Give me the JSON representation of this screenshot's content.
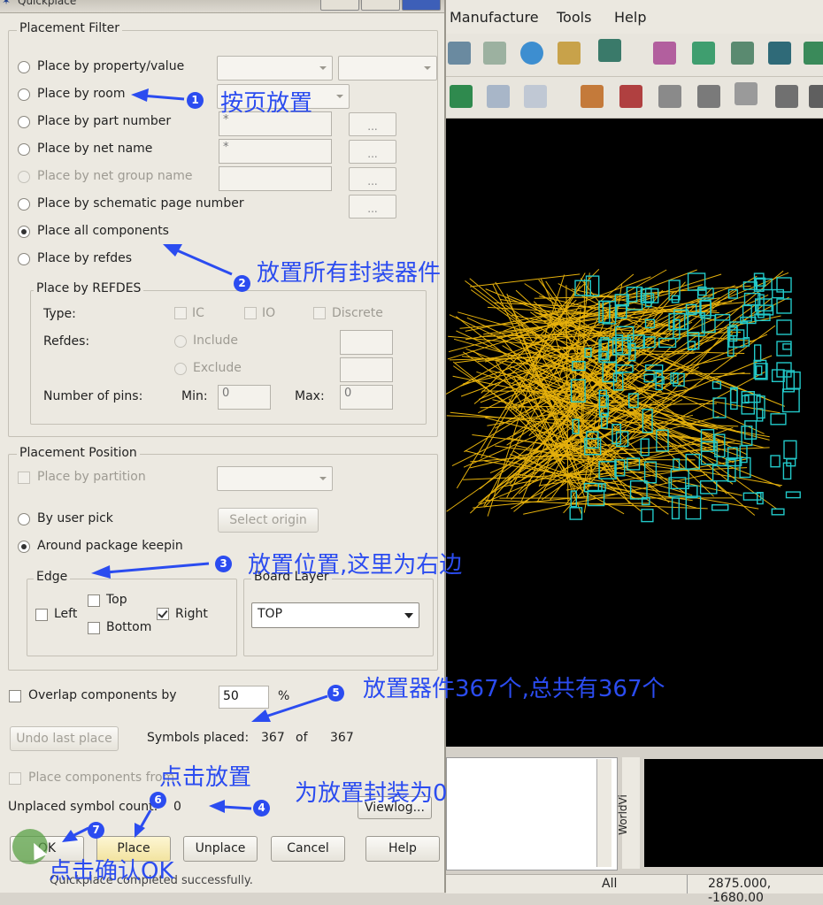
{
  "dialog": {
    "title": "Quickplace",
    "placement_filter": {
      "legend": "Placement Filter",
      "options": [
        {
          "label": "Place by property/value"
        },
        {
          "label": "Place by room"
        },
        {
          "label": "Place by part number",
          "field": "*"
        },
        {
          "label": "Place by net name",
          "field": "*"
        },
        {
          "label": "Place by net group name",
          "field": ""
        },
        {
          "label": "Place by schematic page number"
        },
        {
          "label": "Place all components",
          "selected": true
        },
        {
          "label": "Place by refdes"
        }
      ],
      "browse_label": "..."
    },
    "refdes_group": {
      "legend": "Place by REFDES",
      "type_label": "Type:",
      "type_options": [
        "IC",
        "IO",
        "Discrete"
      ],
      "refdes_label": "Refdes:",
      "include_label": "Include",
      "exclude_label": "Exclude",
      "pins_label": "Number of pins:",
      "min_label": "Min:",
      "min_value": "0",
      "max_label": "Max:",
      "max_value": "0"
    },
    "placement_position": {
      "legend": "Placement Position",
      "partition_label": "Place by partition",
      "user_pick_label": "By user pick",
      "select_origin_label": "Select origin",
      "around_keepin_label": "Around package keepin",
      "edge_legend": "Edge",
      "edge_left": "Left",
      "edge_top": "Top",
      "edge_bottom": "Bottom",
      "edge_right": "Right",
      "board_layer_legend": "Board Layer",
      "board_layer_value": "TOP"
    },
    "overlap_label": "Overlap components by",
    "overlap_value": "50",
    "overlap_unit": "%",
    "undo_label": "Undo last place",
    "symbols_placed_label": "Symbols placed:",
    "symbols_placed_value": "367",
    "of_label": "of",
    "symbols_total_value": "367",
    "place_from_label": "Place components from",
    "unplaced_label": "Unplaced symbol count:",
    "unplaced_value": "0",
    "viewlog_label": "Viewlog...",
    "buttons": {
      "ok": "OK",
      "place": "Place",
      "unplace": "Unplace",
      "cancel": "Cancel",
      "help": "Help"
    },
    "status": "Quickplace completed successfully."
  },
  "annotations": {
    "a1": {
      "badge": "1",
      "text": "按页放置"
    },
    "a2": {
      "badge": "2",
      "text": "放置所有封装器件"
    },
    "a3": {
      "badge": "3",
      "text": "放置位置,这里为右边"
    },
    "a4": {
      "badge": "4",
      "text": "为放置封装为0"
    },
    "a5": {
      "badge": "5",
      "text": "放置器件367个,总共有367个"
    },
    "a6": {
      "badge": "6",
      "text": "点击放置"
    },
    "a7": {
      "badge": "7",
      "text": "点击确认OK"
    }
  },
  "app": {
    "menu": [
      "Manufacture",
      "Tools",
      "Help"
    ],
    "worldview_label": "WorldVi",
    "status_mode": "All",
    "status_coords": "2875.000, -1680.00"
  },
  "colors": {
    "annotation": "#2b4cf0",
    "ratsnest": "#e6b10c",
    "component": "#22c9c9",
    "board_bg": "#000000"
  }
}
